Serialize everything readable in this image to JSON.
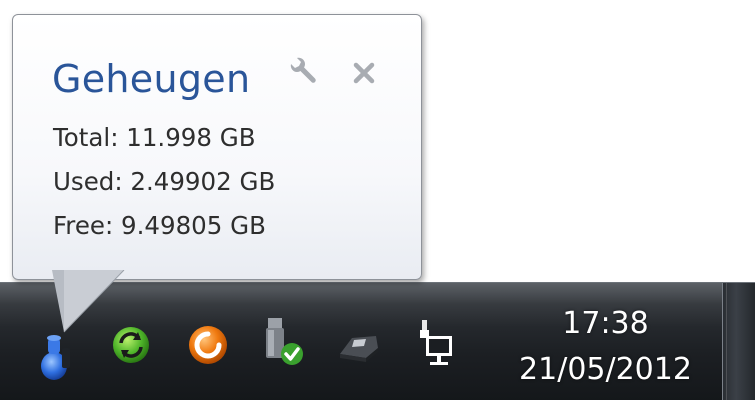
{
  "balloon": {
    "title": "Geheugen",
    "total": "Total: 11.998 GB",
    "used": "Used: 2.49902 GB",
    "free": "Free: 9.49805 GB",
    "options_icon": "wrench-icon",
    "close_icon": "close-icon"
  },
  "tray": {
    "icons": [
      {
        "name": "memory-gadget-icon"
      },
      {
        "name": "sync-icon"
      },
      {
        "name": "orange-app-icon"
      },
      {
        "name": "safely-remove-hardware-icon"
      },
      {
        "name": "drive-icon"
      },
      {
        "name": "network-icon"
      }
    ]
  },
  "clock": {
    "time": "17:38",
    "date": "21/05/2012"
  },
  "colors": {
    "title": "#2a5599",
    "text": "#2e2e2e",
    "taskbar_dark": "#1c1f23",
    "clock_text": "#ffffff"
  }
}
